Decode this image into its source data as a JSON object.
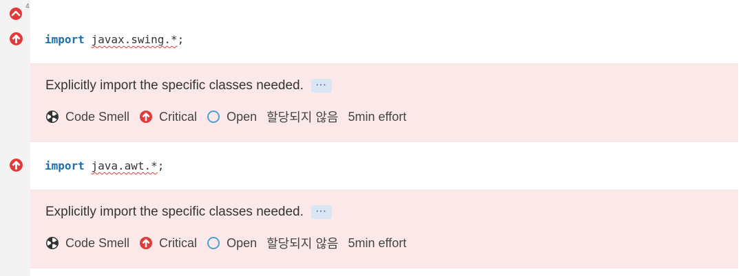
{
  "gutter": {
    "issue_count": "4"
  },
  "lines": [
    {
      "keyword": "import",
      "package": "javax.swing.*",
      "terminator": ";"
    },
    {
      "keyword": "import",
      "package": "java.awt.*",
      "terminator": ";"
    }
  ],
  "issues": [
    {
      "message": "Explicitly import the specific classes needed.",
      "more_label": "···",
      "type": "Code Smell",
      "type_icon": "code-smell-icon",
      "severity": "Critical",
      "severity_icon": "critical-icon",
      "status": "Open",
      "status_icon": "open-status-icon",
      "assignee": "할당되지 않음",
      "effort": "5min effort"
    },
    {
      "message": "Explicitly import the specific classes needed.",
      "more_label": "···",
      "type": "Code Smell",
      "type_icon": "code-smell-icon",
      "severity": "Critical",
      "severity_icon": "critical-icon",
      "status": "Open",
      "status_icon": "open-status-icon",
      "assignee": "할당되지 않음",
      "effort": "5min effort"
    }
  ],
  "colors": {
    "critical": "#e03a3a",
    "issue_background": "#fbe9e9",
    "keyword": "#1a70a8",
    "open_status": "#4b9fd5",
    "more_button": "#dbe6f5",
    "gutter": "#f3f3f3"
  }
}
